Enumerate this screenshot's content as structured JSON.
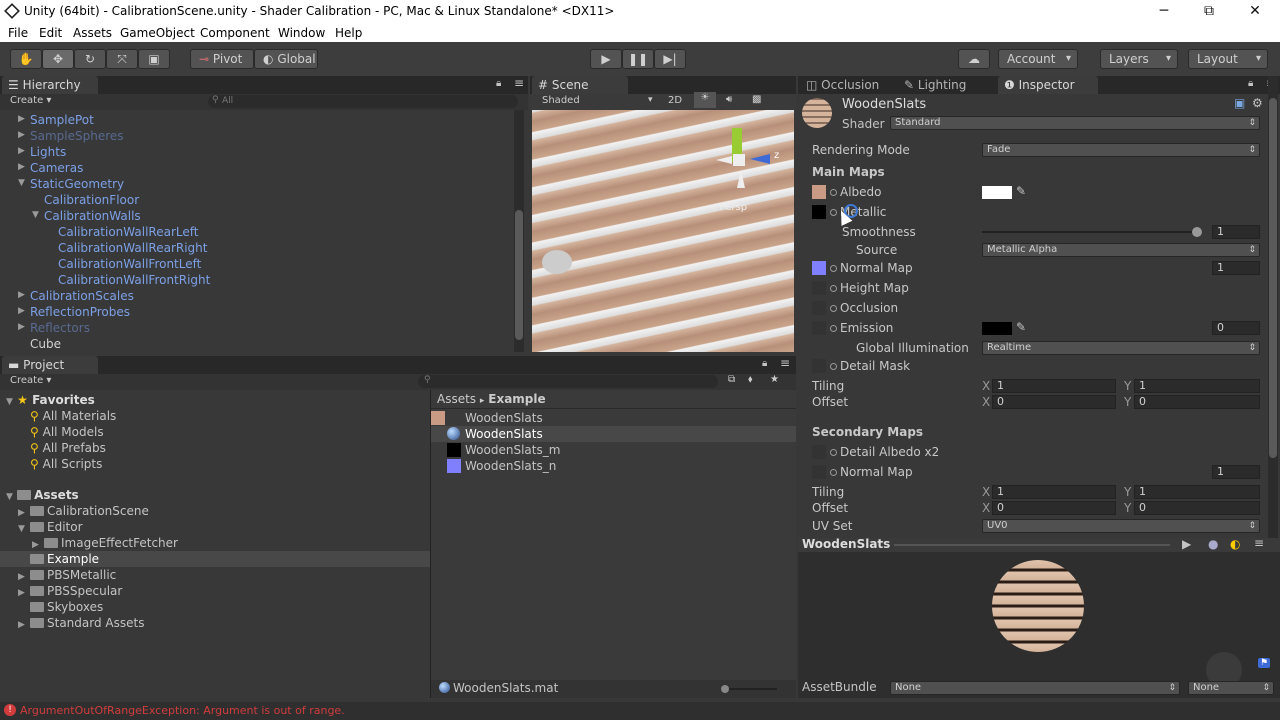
{
  "window": {
    "title": "Unity (64bit) - CalibrationScene.unity - Shader Calibration - PC, Mac & Linux Standalone* <DX11>",
    "min": "─",
    "max": "⧉",
    "close": "✕"
  },
  "menu": [
    "File",
    "Edit",
    "Assets",
    "GameObject",
    "Component",
    "Window",
    "Help"
  ],
  "toolbar": {
    "pivot": "Pivot",
    "global": "Global",
    "account": "Account",
    "layers": "Layers",
    "layout": "Layout"
  },
  "hierarchy": {
    "tab": "Hierarchy",
    "create": "Create",
    "search_placeholder": "All",
    "items": [
      {
        "label": "SamplePot",
        "style": "blue"
      },
      {
        "label": "SampleSpheres",
        "style": "dim"
      },
      {
        "label": "Lights",
        "style": "blue"
      },
      {
        "label": "Cameras",
        "style": "blue"
      },
      {
        "label": "StaticGeometry",
        "style": "blue"
      },
      {
        "label": "CalibrationFloor",
        "style": "blue"
      },
      {
        "label": "CalibrationWalls",
        "style": "blue"
      },
      {
        "label": "CalibrationWallRearLeft",
        "style": "blue"
      },
      {
        "label": "CalibrationWallRearRight",
        "style": "blue"
      },
      {
        "label": "CalibrationWallFrontLeft",
        "style": "blue"
      },
      {
        "label": "CalibrationWallFrontRight",
        "style": "blue"
      },
      {
        "label": "CalibrationScales",
        "style": "blue"
      },
      {
        "label": "ReflectionProbes",
        "style": "blue"
      },
      {
        "label": "Reflectors",
        "style": "dim"
      },
      {
        "label": "Cube",
        "style": "white"
      }
    ]
  },
  "scene": {
    "tab": "Scene",
    "shaded": "Shaded",
    "mode2d": "2D",
    "persp": "Persp",
    "axis_z": "z"
  },
  "project": {
    "tab": "Project",
    "create": "Create",
    "favorites_title": "Favorites",
    "favorites": [
      "All Materials",
      "All Models",
      "All Prefabs",
      "All Scripts"
    ],
    "assets_title": "Assets",
    "folders": [
      "CalibrationScene",
      "Editor",
      "ImageEffectFetcher",
      "Example",
      "PBSMetallic",
      "PBSSpecular",
      "Skyboxes",
      "Standard Assets"
    ],
    "breadcrumb_root": "Assets",
    "breadcrumb_sep": "▸",
    "breadcrumb_current": "Example",
    "files": [
      "WoodenSlats",
      "WoodenSlats",
      "WoodenSlats_m",
      "WoodenSlats_n"
    ],
    "status_file": "WoodenSlats.mat"
  },
  "inspector": {
    "tabs": [
      "Occlusion",
      "Lighting",
      "Inspector"
    ],
    "material": "WoodenSlats",
    "shader_label": "Shader",
    "shader": "Standard",
    "rendering_mode_label": "Rendering Mode",
    "rendering_mode": "Fade",
    "main_maps": "Main Maps",
    "albedo": "Albedo",
    "metallic": "Metallic",
    "smoothness": "Smoothness",
    "smoothness_value": "1",
    "smoothness_level": 1.0,
    "source_label": "Source",
    "source": "Metallic Alpha",
    "normal_map": "Normal Map",
    "normal_value": "1",
    "height_map": "Height Map",
    "occlusion": "Occlusion",
    "emission": "Emission",
    "emission_value": "0",
    "gi_label": "Global Illumination",
    "gi": "Realtime",
    "detail_mask": "Detail Mask",
    "tiling": "Tiling",
    "offset": "Offset",
    "x": "X",
    "y": "Y",
    "tiling_x": "1",
    "tiling_y": "1",
    "offset_x": "0",
    "offset_y": "0",
    "secondary_maps": "Secondary Maps",
    "detail_albedo": "Detail Albedo x2",
    "normal_map2": "Normal Map",
    "normal_value2": "1",
    "tiling2_x": "1",
    "tiling2_y": "1",
    "offset2_x": "0",
    "offset2_y": "0",
    "uvset_label": "UV Set",
    "uvset": "UV0"
  },
  "preview": {
    "title": "WoodenSlats",
    "assetbundle_label": "AssetBundle",
    "assetbundle": "None",
    "variant": "None"
  },
  "status": {
    "error": "ArgumentOutOfRangeException: Argument is out of range."
  },
  "colors": {
    "bg": "#383838",
    "accent": "#3d6aa6",
    "error": "#d23c3c",
    "wood": "#c99a84",
    "normal": "#8080ff"
  }
}
